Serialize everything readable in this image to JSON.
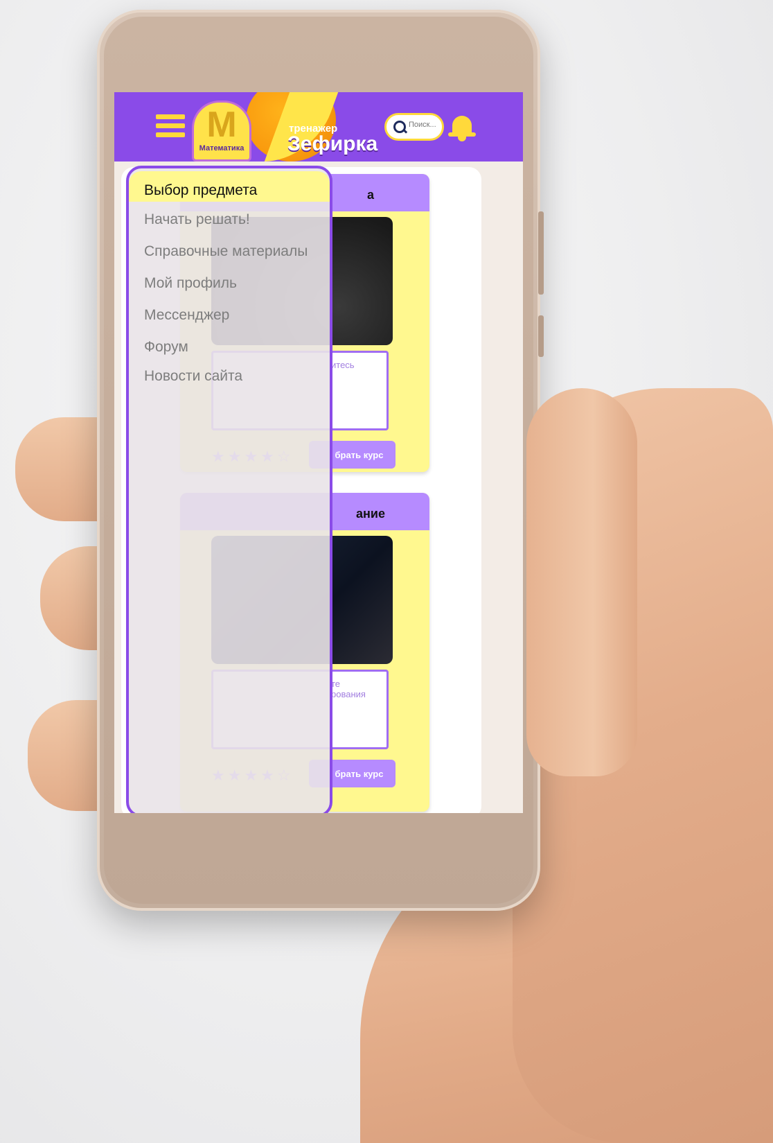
{
  "header": {
    "logo_letter": "M",
    "logo_caption": "Математика",
    "brand_small": "тренажер",
    "brand_big": "Зефирка",
    "search_placeholder": "Поиск..."
  },
  "menu": {
    "items": [
      {
        "label": "Выбор предмета",
        "active": true
      },
      {
        "label": "Начать решать!",
        "active": false
      },
      {
        "label": "Справочные материалы",
        "active": false
      },
      {
        "label": "Мой профиль",
        "active": false
      },
      {
        "label": "Мессенджер",
        "active": false
      },
      {
        "label": "Форум",
        "active": false
      },
      {
        "label": "Новости сайта",
        "active": false
      }
    ]
  },
  "cards": [
    {
      "title": "Математика",
      "title_visible": "а",
      "desc_visible": "итесь",
      "button_visible": "брать курс",
      "rating": "★★★★☆"
    },
    {
      "title": "Программирование",
      "title_visible": "ание",
      "desc_visible": "те\nрования",
      "button_visible": "брать курс",
      "rating": "★★★★☆"
    }
  ],
  "colors": {
    "primary": "#8a4be8",
    "accent": "#ffd93b",
    "card_bg": "#fff88f",
    "card_header": "#b68bff"
  },
  "icons": {
    "menu": "hamburger-icon",
    "search": "search-icon",
    "notifications": "bell-icon"
  }
}
